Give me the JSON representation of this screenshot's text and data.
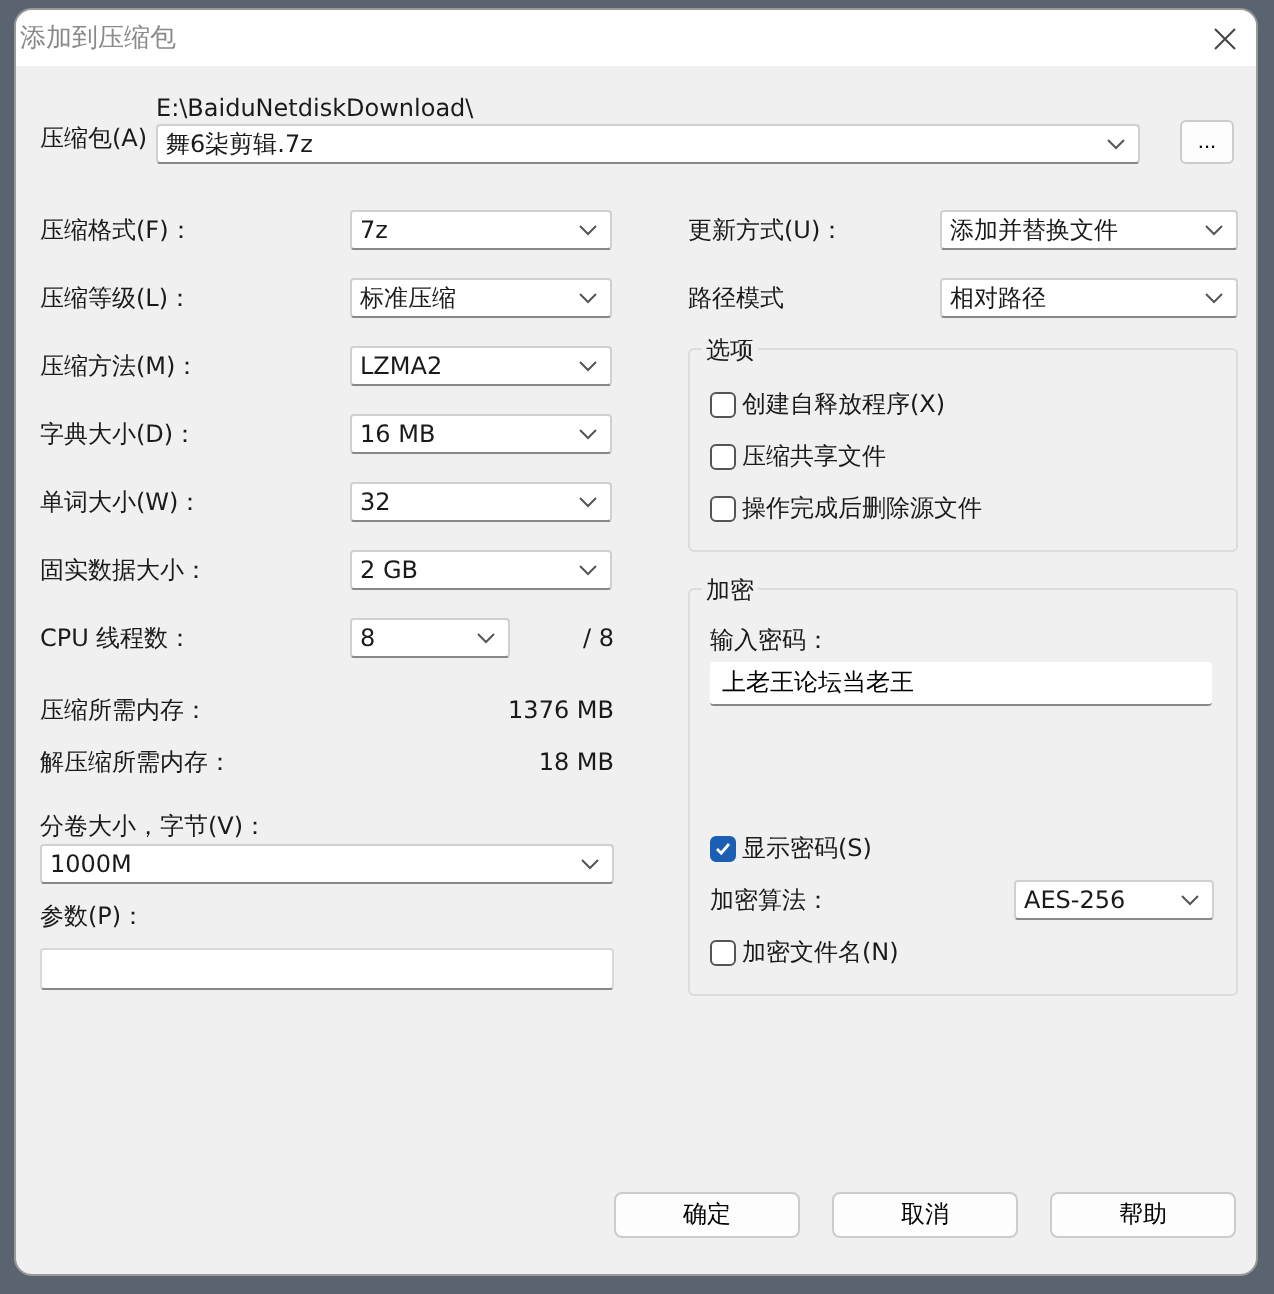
{
  "window": {
    "title": "添加到压缩包"
  },
  "archive": {
    "label": "压缩包(A)",
    "path": "E:\\BaiduNetdiskDownload\\",
    "value": "舞6柒剪辑.7z",
    "browse_button": "..."
  },
  "left_settings": [
    {
      "label": "压缩格式(F)：",
      "value": "7z"
    },
    {
      "label": "压缩等级(L)：",
      "value": "标准压缩"
    },
    {
      "label": "压缩方法(M)：",
      "value": "LZMA2"
    },
    {
      "label": "字典大小(D)：",
      "value": "16 MB"
    },
    {
      "label": "单词大小(W)：",
      "value": "32"
    },
    {
      "label": "固实数据大小：",
      "value": "2 GB"
    }
  ],
  "threads": {
    "label": "CPU 线程数：",
    "value": "8",
    "max": "/ 8"
  },
  "memory": [
    {
      "label": "压缩所需内存：",
      "value": "1376 MB"
    },
    {
      "label": "解压缩所需内存：",
      "value": "18 MB"
    }
  ],
  "volume": {
    "label": "分卷大小，字节(V)：",
    "value": "1000M"
  },
  "parameters": {
    "label": "参数(P)："
  },
  "right_settings": [
    {
      "label": "更新方式(U)：",
      "value": "添加并替换文件"
    },
    {
      "label": "路径模式",
      "value": "相对路径"
    }
  ],
  "options": {
    "title": "选项",
    "items": [
      {
        "label": "创建自释放程序(X)",
        "checked": false
      },
      {
        "label": "压缩共享文件",
        "checked": false
      },
      {
        "label": "操作完成后删除源文件",
        "checked": false
      }
    ]
  },
  "encryption": {
    "title": "加密",
    "password_label": "输入密码：",
    "password": "上老王论坛当老王",
    "show_password": {
      "label": "显示密码(S)",
      "checked": true
    },
    "method_label": "加密算法：",
    "method": "AES-256",
    "encrypt_names": {
      "label": "加密文件名(N)",
      "checked": false
    }
  },
  "buttons": [
    "确定",
    "取消",
    "帮助"
  ]
}
